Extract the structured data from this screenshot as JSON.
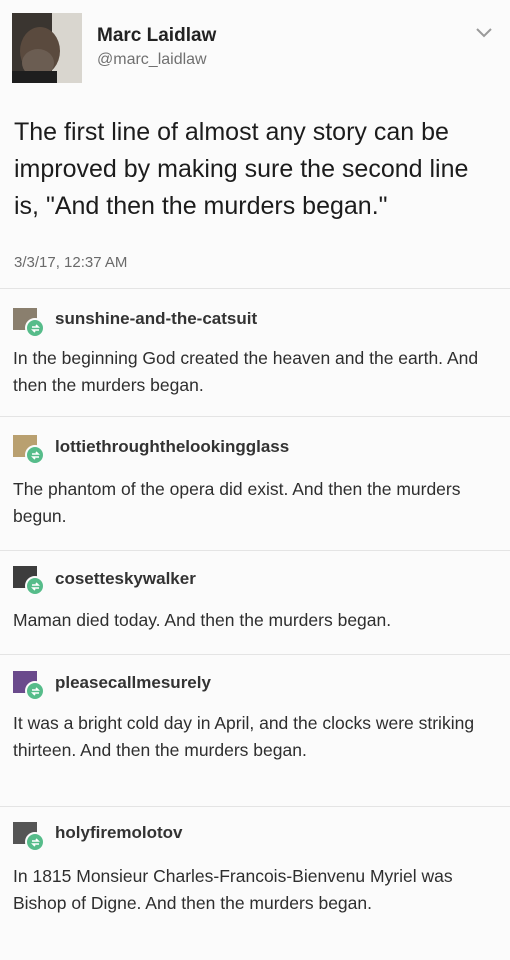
{
  "tweet": {
    "name": "Marc Laidlaw",
    "handle": "@marc_laidlaw",
    "text": "The first line of almost any story can be improved by making sure the second line is, \"And then the murders began.\"",
    "date": "3/3/17, 12:37 AM",
    "menu_icon": "chevron-down-icon"
  },
  "posts": [
    {
      "username": "sunshine-and-the-catsuit",
      "text": "In the beginning God created the heaven and the earth. And then the murders began.",
      "avatar_color": "#8a7f6e"
    },
    {
      "username": "lottiethroughthelookingglass",
      "text": "The phantom of the opera did exist. And then the murders begun.",
      "avatar_color": "#b9a070"
    },
    {
      "username": "cosetteskywalker",
      "text": "Maman died today. And then the murders began.",
      "avatar_color": "#3d3d3d"
    },
    {
      "username": "pleasecallmesurely",
      "text": "It was a bright cold day in April, and the clocks were striking thirteen. And then the murders began.",
      "avatar_color": "#6a4a8c"
    },
    {
      "username": "holyfiremolotov",
      "text": "In 1815 Monsieur Charles-Francois-Bienvenu Myriel was Bishop of Digne. And then the murders began.",
      "avatar_color": "#555555"
    }
  ],
  "colors": {
    "reblog_badge": "#56bc8a",
    "separator": "#e4e4e4",
    "background": "#fbfbfb"
  }
}
